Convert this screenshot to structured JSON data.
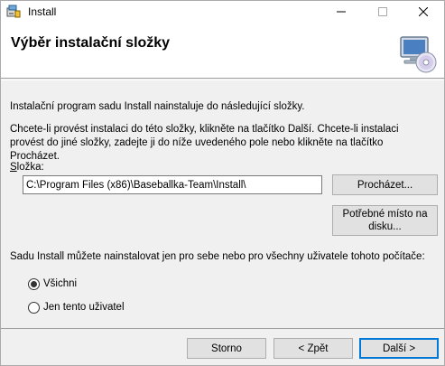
{
  "window": {
    "title": "Install",
    "controls": {
      "minimize": "—",
      "maximize": "☐",
      "close": "✕"
    }
  },
  "header": {
    "title": "Výběr instalační složky",
    "icon": "computer-cd-icon"
  },
  "body": {
    "intro": "Instalační program sadu Install nainstaluje do následující složky.",
    "instructions": "Chcete-li provést instalaci do této složky, klikněte na tlačítko Další. Chcete-li instalaci provést do jiné složky, zadejte ji do níže uvedeného pole nebo klikněte na tlačítko Procházet.",
    "folder_label_accel": "S",
    "folder_label_rest": "ložka:",
    "folder_path": "C:\\Program Files (x86)\\Baseballka-Team\\Install\\",
    "browse_button": "Procházet...",
    "disk_space_button": "Potřebné místo na disku...",
    "users_question": "Sadu Install můžete nainstalovat jen pro sebe nebo pro všechny uživatele tohoto počítače:",
    "radio_all": "Všichni",
    "radio_me": "Jen tento uživatel",
    "selected": "all"
  },
  "footer": {
    "cancel": "Storno",
    "back": "< Zpět",
    "next": "Další >"
  }
}
